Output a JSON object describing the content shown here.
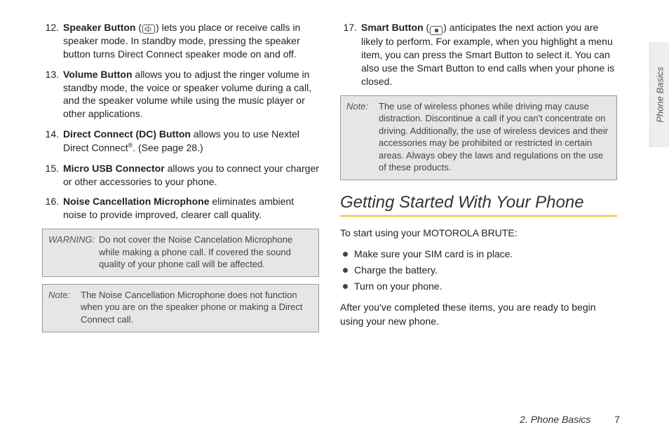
{
  "list": {
    "i12": {
      "num": "12.",
      "term": "Speaker Button",
      "text": " lets you place or receive calls in speaker mode. In standby mode, pressing the speaker button turns Direct Connect speaker mode on and off."
    },
    "i13": {
      "num": "13.",
      "term": "Volume Button",
      "text": " allows you to adjust the ringer volume in standby mode, the voice or speaker volume during a call, and the speaker volume while using the music player or other applications."
    },
    "i14": {
      "num": "14.",
      "term": "Direct Connect (DC) Button",
      "text_a": " allows you to use Nextel Direct Connect",
      "reg": "®",
      "text_b": ". (See page 28.)"
    },
    "i15": {
      "num": "15.",
      "term": "Micro USB Connector",
      "text": " allows you to connect your charger or other accessories to your phone."
    },
    "i16": {
      "num": "16.",
      "term": "Noise Cancellation Microphone",
      "text": " eliminates ambient noise to provide improved, clearer call quality."
    },
    "i17": {
      "num": "17.",
      "term": "Smart Button",
      "text": " anticipates the next action you are likely to perform. For example, when you highlight a menu item, you can press the Smart Button to select it. You can also use the Smart Button to end calls when your phone is closed."
    }
  },
  "warning": {
    "label": "WARNING:",
    "text": "Do not cover the Noise Cancelation Microphone while making a phone call.  If covered the sound quality of your phone call will be affected."
  },
  "note1": {
    "label": "Note:",
    "text": "The Noise Cancellation Microphone does not function when you are on the speaker phone or making a Direct Connect call."
  },
  "note2": {
    "label": "Note:",
    "text": "The use of wireless phones while driving may cause distraction. Discontinue a call if you can't concentrate on driving. Additionally, the use of wireless devices and their accessories may be prohibited or restricted in certain areas. Always obey the laws and regulations on the use of these products."
  },
  "section": {
    "title": "Getting Started With Your Phone",
    "intro": "To start using your MOTOROLA BRUTE:",
    "bullets": [
      "Make sure your SIM card is in place.",
      "Charge the battery.",
      "Turn on your phone."
    ],
    "outro": "After you've completed these items, you are ready to begin using your new phone."
  },
  "tab": "Phone Basics",
  "footer": {
    "chapter": "2. Phone Basics",
    "page": "7"
  }
}
